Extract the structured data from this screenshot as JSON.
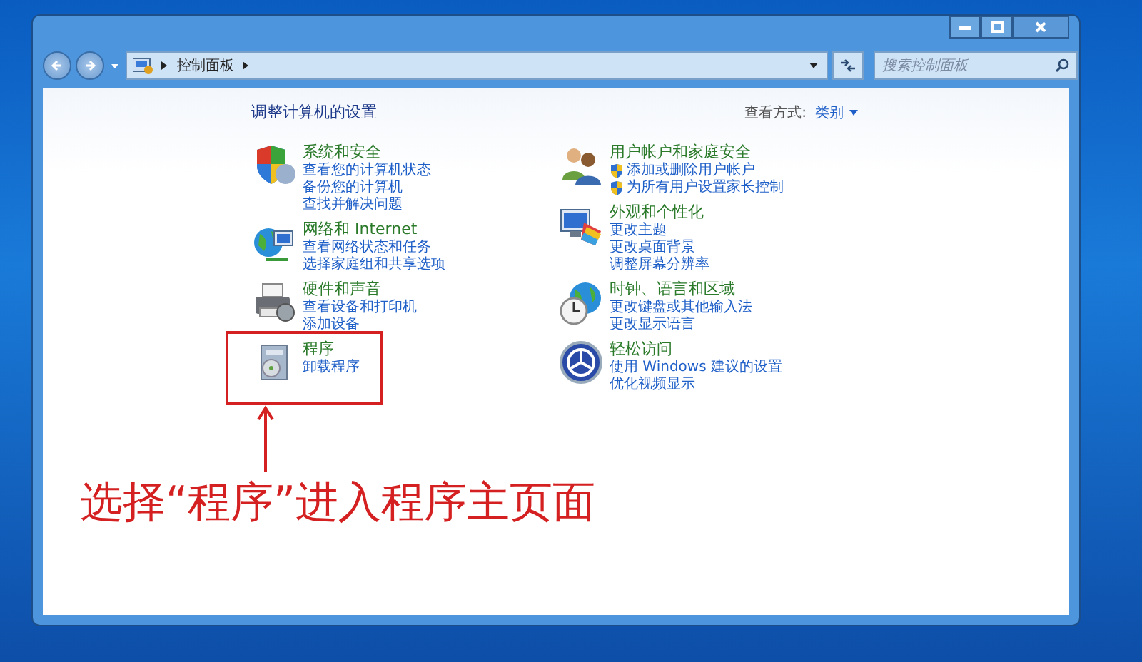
{
  "address_bar": {
    "breadcrumb": "控制面板"
  },
  "search": {
    "placeholder": "搜索控制面板"
  },
  "header": {
    "title": "调整计算机的设置",
    "view_by_label": "查看方式:",
    "view_by_value": "类别"
  },
  "left_column": [
    {
      "title": "系统和安全",
      "highlighted": false,
      "links": [
        {
          "text": "查看您的计算机状态",
          "shield": false
        },
        {
          "text": "备份您的计算机",
          "shield": false
        },
        {
          "text": "查找并解决问题",
          "shield": false
        }
      ]
    },
    {
      "title": "网络和 Internet",
      "highlighted": false,
      "links": [
        {
          "text": "查看网络状态和任务",
          "shield": false
        },
        {
          "text": "选择家庭组和共享选项",
          "shield": false
        }
      ]
    },
    {
      "title": "硬件和声音",
      "highlighted": false,
      "links": [
        {
          "text": "查看设备和打印机",
          "shield": false
        },
        {
          "text": "添加设备",
          "shield": false
        }
      ]
    },
    {
      "title": "程序",
      "highlighted": true,
      "links": [
        {
          "text": "卸载程序",
          "shield": false
        }
      ]
    }
  ],
  "right_column": [
    {
      "title": "用户帐户和家庭安全",
      "highlighted": false,
      "links": [
        {
          "text": "添加或删除用户帐户",
          "shield": true
        },
        {
          "text": "为所有用户设置家长控制",
          "shield": true
        }
      ]
    },
    {
      "title": "外观和个性化",
      "highlighted": false,
      "links": [
        {
          "text": "更改主题",
          "shield": false
        },
        {
          "text": "更改桌面背景",
          "shield": false
        },
        {
          "text": "调整屏幕分辨率",
          "shield": false
        }
      ]
    },
    {
      "title": "时钟、语言和区域",
      "highlighted": false,
      "links": [
        {
          "text": "更改键盘或其他输入法",
          "shield": false
        },
        {
          "text": "更改显示语言",
          "shield": false
        }
      ]
    },
    {
      "title": "轻松访问",
      "highlighted": false,
      "links": [
        {
          "text": "使用 Windows 建议的设置",
          "shield": false
        },
        {
          "text": "优化视频显示",
          "shield": false
        }
      ]
    }
  ],
  "annotation": {
    "text": "选择“程序”进入程序主页面"
  }
}
